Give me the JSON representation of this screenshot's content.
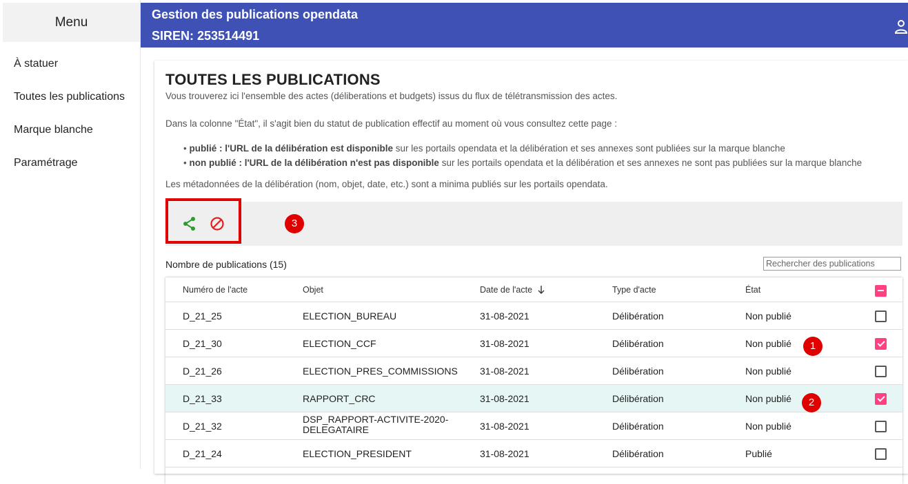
{
  "sidebar": {
    "title": "Menu",
    "items": [
      {
        "label": "À statuer"
      },
      {
        "label": "Toutes les publications"
      },
      {
        "label": "Marque blanche"
      },
      {
        "label": "Paramétrage"
      }
    ]
  },
  "header": {
    "title": "Gestion des publications opendata",
    "siren": "SIREN: 253514491",
    "user_icon": "person-icon"
  },
  "main": {
    "title": "TOUTES LES PUBLICATIONS",
    "intro": "Vous trouverez ici l'ensemble des actes (déliberations et budgets) issus du flux de télétransmission des actes.",
    "note": "Dans la colonne \"État\", il s'agit bien du statut de publication effectif au moment où vous consultez cette page :",
    "bullets": [
      {
        "bold": "publié : l'URL de la délibération est disponible",
        "rest": " sur les portails opendata et la délibération et ses annexes sont publiées sur la marque blanche"
      },
      {
        "bold": "non publié : l'URL de la délibération n'est pas disponible",
        "rest": " sur les portails opendata et la délibération et ses annexes ne sont pas publiées sur la marque blanche"
      }
    ],
    "metadata_note": "Les métadonnées de la délibération (nom, objet, date, etc.) sont a minima publiés sur les portails opendata.",
    "toolbar": {
      "share_icon": "share-icon",
      "block_icon": "block-icon"
    },
    "markers": [
      "1",
      "2",
      "3"
    ],
    "count": "Nombre de publications (15)",
    "search": {
      "placeholder": "Rechercher des publications",
      "value": ""
    },
    "table": {
      "headers": [
        "Numéro de l'acte",
        "Objet",
        "Date de l'acte",
        "Type d'acte",
        "État"
      ],
      "sort_icon": "arrow-down-icon",
      "rows": [
        {
          "numero": "D_21_25",
          "objet": "ELECTION_BUREAU",
          "date": "31-08-2021",
          "type": "Délibération",
          "etat": "Non publié",
          "checked": false
        },
        {
          "numero": "D_21_30",
          "objet": "ELECTION_CCF",
          "date": "31-08-2021",
          "type": "Délibération",
          "etat": "Non publié",
          "checked": true
        },
        {
          "numero": "D_21_26",
          "objet": "ELECTION_PRES_COMMISSIONS",
          "date": "31-08-2021",
          "type": "Délibération",
          "etat": "Non publié",
          "checked": false
        },
        {
          "numero": "D_21_33",
          "objet": "RAPPORT_CRC",
          "date": "31-08-2021",
          "type": "Délibération",
          "etat": "Non publié",
          "checked": true
        },
        {
          "numero": "D_21_32",
          "objet": "DSP_RAPPORT-ACTIVITE-2020-DELEGATAIRE",
          "objet_lines": [
            "DSP_RAPPORT-ACTIVITE-2020-",
            "DELEGATAIRE"
          ],
          "date": "31-08-2021",
          "type": "Délibération",
          "etat": "Non publié",
          "checked": false
        },
        {
          "numero": "D_21_24",
          "objet": "ELECTION_PRESIDENT",
          "date": "31-08-2021",
          "type": "Délibération",
          "etat": "Publié",
          "checked": false
        }
      ]
    }
  }
}
